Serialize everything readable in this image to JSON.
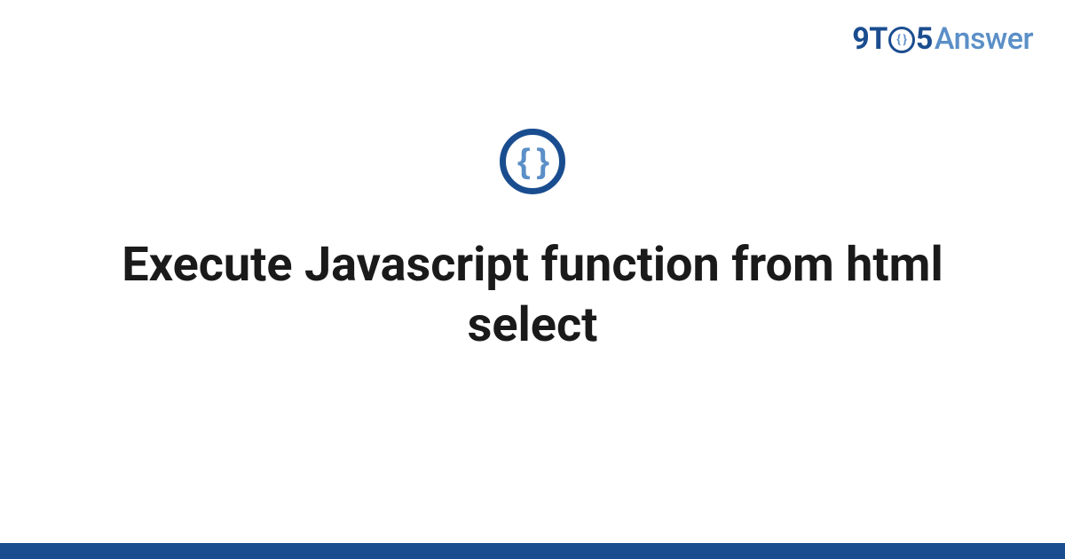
{
  "logo": {
    "nine": "9",
    "t": "T",
    "o_inner": "{ }",
    "five": "5",
    "answer": "Answer"
  },
  "icon": {
    "braces": "{ }"
  },
  "title": "Execute Javascript function from html select"
}
